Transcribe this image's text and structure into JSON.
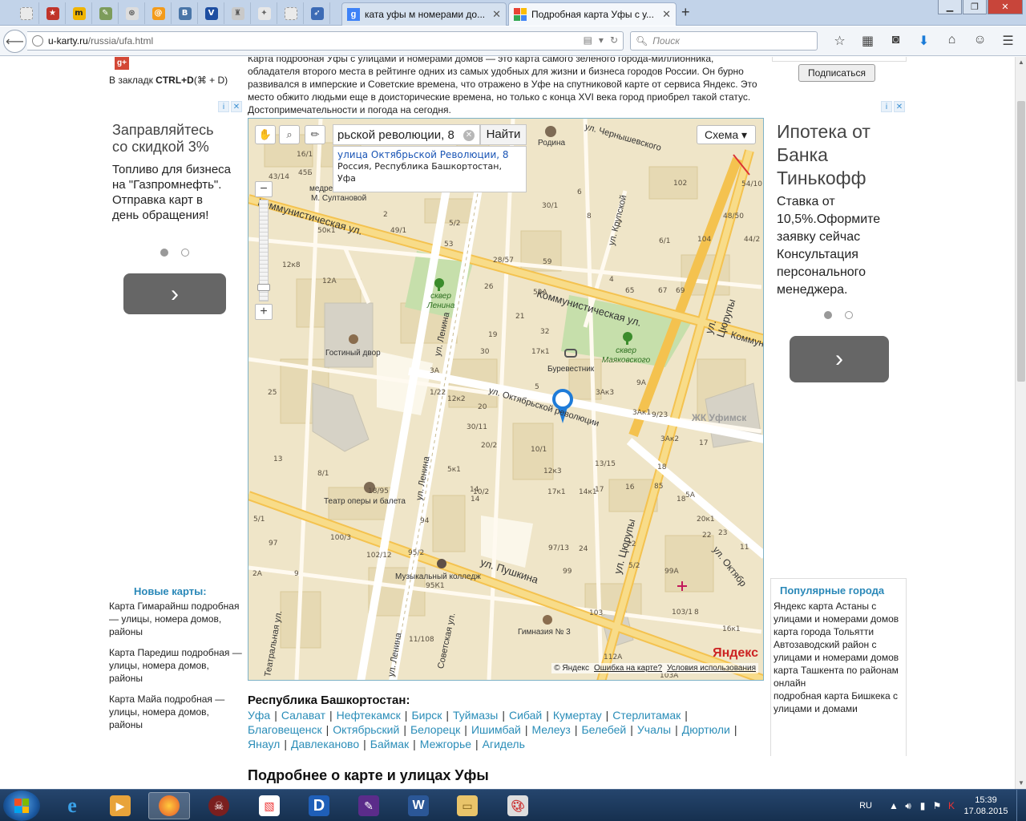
{
  "browser": {
    "tabs": [
      {
        "label": "ката уфы м номерами до...",
        "active": false
      },
      {
        "label": "Подробная карта Уфы с у...",
        "active": true
      }
    ],
    "new_tab": "+",
    "url_domain": "u-karty.ru",
    "url_path": "/russia/ufa.html",
    "search_placeholder": "Поиск"
  },
  "left": {
    "gplus": "g+",
    "bookmark_prefix": "В закладк ",
    "bookmark_keys": "CTRL+D",
    "bookmark_suffix": "(⌘ + D)",
    "ad": {
      "title": "Заправляйтесь со скидкой 3%",
      "text": "Топливо для бизнеса на \"Газпромнефть\". Отправка карт в день обращения!",
      "button": "›"
    },
    "new_maps_heading": "Новые карты:",
    "new_maps": [
      "Карта Гимарайнш подробная — улицы, номера домов, районы",
      "Карта Паредиш подробная — улицы, номера домов, районы",
      "Карта Майа подробная — улицы, номера домов, районы"
    ]
  },
  "main": {
    "intro": "Карта подробная Уфы с улицами и номерами домов — это карта самого зеленого города-миллионника, обладателя второго места в рейтинге одних из самых удобных для жизни и бизнеса городов России.  Он бурно развивался в имперские и Советские времена, что отражено в Уфе на спутниковой карте от сервиса Яндекс. Это место обжито людьми еще в доисторические времена, но только с конца XVI века город приобрел такой статус. Достопримечательности и погода на сегодня.",
    "map": {
      "search_value": "рьской революции, 8",
      "find_button": "Найти",
      "scheme_button": "Схема ▾",
      "suggest_title": "улица Октябрьской Революции, 8",
      "suggest_subtitle": "Россия, Республика Башкортостан, Уфа",
      "copyright": "© Яндекс",
      "error_link": "Ошибка на карте?",
      "terms_link": "Условия использования",
      "logo": "Яндекс",
      "streets": {
        "kommunisticheskaya_left": "Коммунистическая ул.",
        "kommunisticheskaya_right": "Коммунистическая ул.",
        "kommunisticheskaya_edge": "Коммун",
        "oktyabrskoy": "ул. Октябрьской революции",
        "lenina_top": "ул. Ленина",
        "lenina_bottom": "ул. Ленина",
        "lenina_far": "ул. Ленина",
        "tsyurupy_top": "ул. Цюрупы",
        "tsyurupy_bottom": "ул. Цюрупы",
        "pushkina": "ул. Пушкина",
        "sovetskaya": "Советская ул.",
        "teatralnaya": "Театральная ул.",
        "krupskoy": "ул. Крупской",
        "chernyshevskogo": "ул. Чернышевского",
        "oktyabr_right": "ул. Октябр"
      },
      "places": {
        "rodina": "Родина",
        "medres": "медре",
        "sultanovoy": "М. Султановой",
        "skver_lenina": "сквер Ленина",
        "skver_mayak": "сквер Маяковского",
        "gostiny": "Гостиный двор",
        "burevestnik": "Буревестник",
        "zhk": "ЖК Уфимск",
        "teatr": "Театр оперы и балета",
        "kolledzh": "Музыкальный колледж",
        "gimnaziya": "Гимназия № 3"
      },
      "house_numbers": [
        "16/1",
        "43/14",
        "45Б",
        "2",
        "49/1",
        "5/2",
        "53",
        "50к1",
        "12к8",
        "12А",
        "28/57",
        "30/1",
        "59",
        "6",
        "8",
        "102",
        "7",
        "104",
        "6/1",
        "4",
        "65",
        "67",
        "69",
        "48/50",
        "44/2",
        "54/10",
        "26",
        "52А",
        "21",
        "32",
        "19",
        "30",
        "17к1",
        "3А",
        "1/22",
        "5",
        "3Ак3",
        "9А",
        "25",
        "12к2",
        "20",
        "3Ак1",
        "9/23",
        "30/11",
        "20/2",
        "10/1",
        "13/15",
        "3Ак2",
        "17",
        "13",
        "5к1",
        "12к3",
        "18",
        "8/1",
        "14",
        "17",
        "85",
        "5А",
        "18/95",
        "10/2",
        "17к1",
        "14к1",
        "16",
        "18",
        "20к1",
        "22",
        "23",
        "11",
        "14",
        "94",
        "5/1",
        "97",
        "100/3",
        "102/12",
        "95/2",
        "97/13",
        "24",
        "22",
        "5/2",
        "2А",
        "9",
        "95К1",
        "99",
        "99А",
        "103/1",
        "8",
        "11/108",
        "103",
        "16к1",
        "112А",
        "103А"
      ],
      "location_marker": "pin"
    }
  },
  "region_heading": "Республика Башкортостан:",
  "cities": [
    "Уфа",
    "Салават",
    "Нефтекамск",
    "Бирск",
    "Туймазы",
    "Сибай",
    "Кумертау",
    "Стерлитамак",
    "Благовещенск",
    "Октябрьский",
    "Белорецк",
    "Ишимбай",
    "Мелеуз",
    "Белебей",
    "Учалы",
    "Дюртюли",
    "Янаул",
    "Давлеканово",
    "Баймак",
    "Межгорье",
    "Агидель"
  ],
  "more_heading": "Подробнее о карте и улицах Уфы",
  "right": {
    "subscribe_button": "Подписаться",
    "ad": {
      "title": "Ипотека от Банка Тинькофф",
      "text": "Ставка от 10,5%.Оформите заявку сейчас Консультация персонального менеджера.",
      "button": "›"
    },
    "popular_heading": "Популярные города",
    "popular": [
      "Яндекс карта Астаны с улицами и номерами домов",
      "карта города Тольятти Автозаводский район с улицами и номерами домов",
      "карта Ташкента по районам онлайн",
      "подробная карта Бишкека с улицами и домами"
    ]
  },
  "taskbar": {
    "lang": "RU",
    "time": "15:39",
    "date": "17.08.2015"
  },
  "colors": {
    "accent_link": "#2a8db8",
    "map_road": "#f6cf6f",
    "map_base": "#efe5c8",
    "park": "#c6dfab"
  }
}
